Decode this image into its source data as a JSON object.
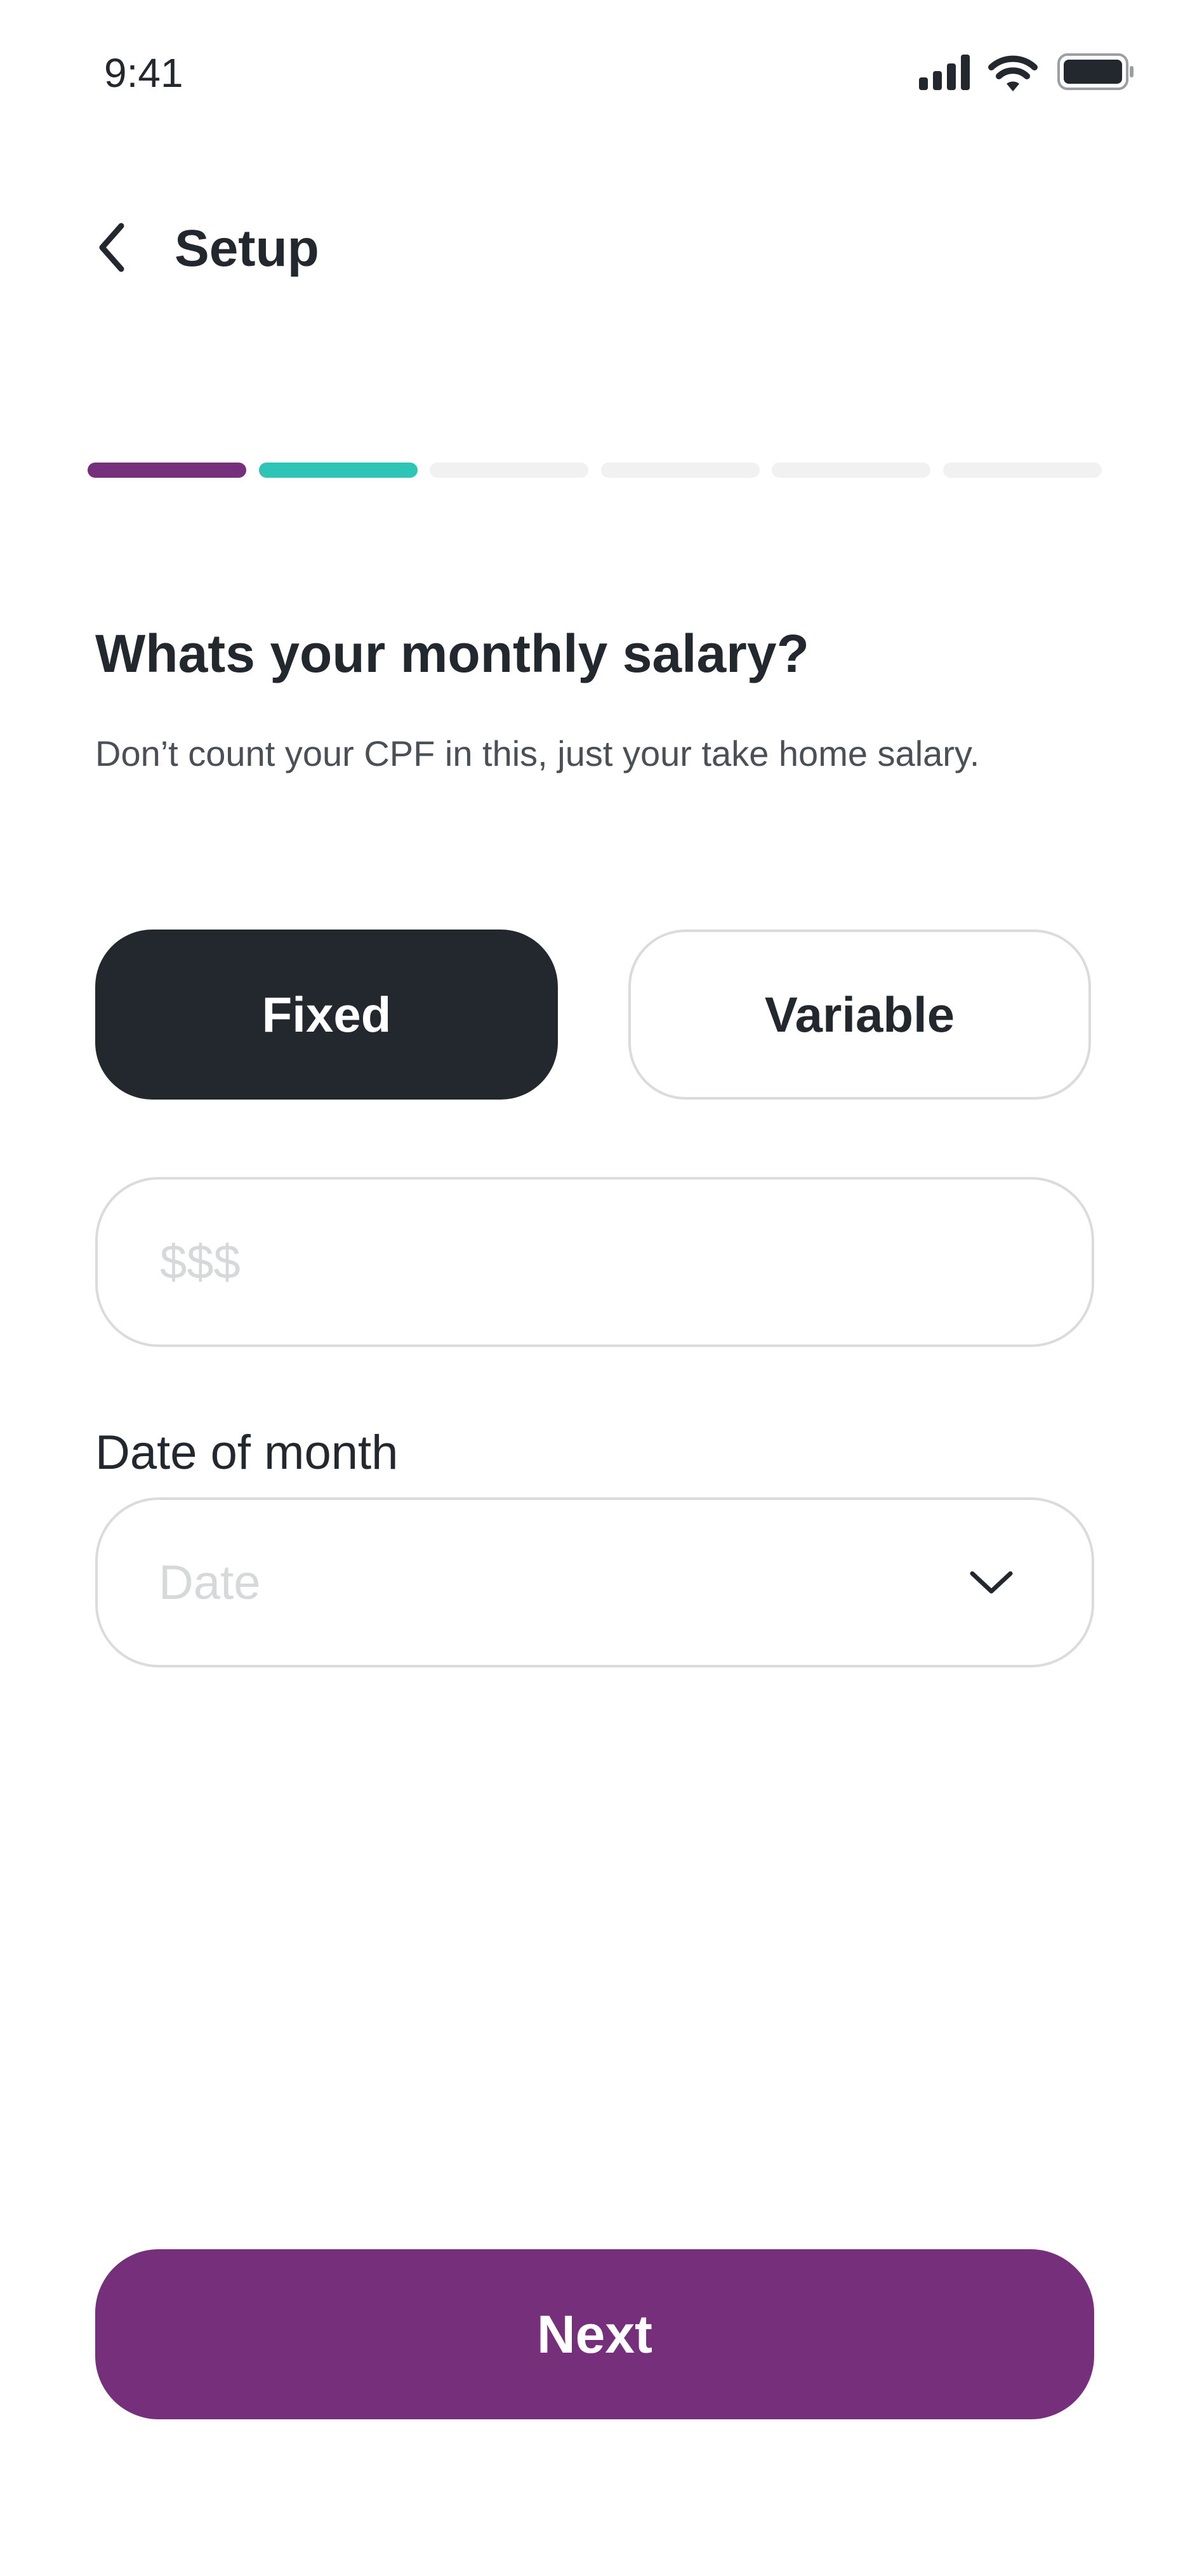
{
  "status_bar": {
    "time": "9:41",
    "icons": [
      "cellular-signal-icon",
      "wifi-icon",
      "battery-icon"
    ]
  },
  "header": {
    "back_icon": "chevron-left-icon",
    "title": "Setup"
  },
  "progress": {
    "total_steps": 6,
    "steps": [
      {
        "color": "#762f7b"
      },
      {
        "color": "#2ec4b6"
      },
      {
        "color": "#f1f1f2"
      },
      {
        "color": "#f1f1f2"
      },
      {
        "color": "#f1f1f2"
      },
      {
        "color": "#f1f1f2"
      }
    ]
  },
  "question": {
    "title": "Whats your monthly salary?",
    "subtitle": "Don’t count your CPF in this, just your take home salary."
  },
  "salary_type": {
    "options": [
      "Fixed",
      "Variable"
    ],
    "selected": "Fixed"
  },
  "amount": {
    "placeholder": "$$$",
    "value": ""
  },
  "date_of_month": {
    "label": "Date of month",
    "placeholder": "Date",
    "icon": "chevron-down-icon"
  },
  "footer": {
    "next_label": "Next"
  },
  "colors": {
    "primary": "#762f7b",
    "accent": "#2ec4b6",
    "dark": "#23272e",
    "border": "#dadbdd",
    "placeholder": "#d7d8da"
  }
}
